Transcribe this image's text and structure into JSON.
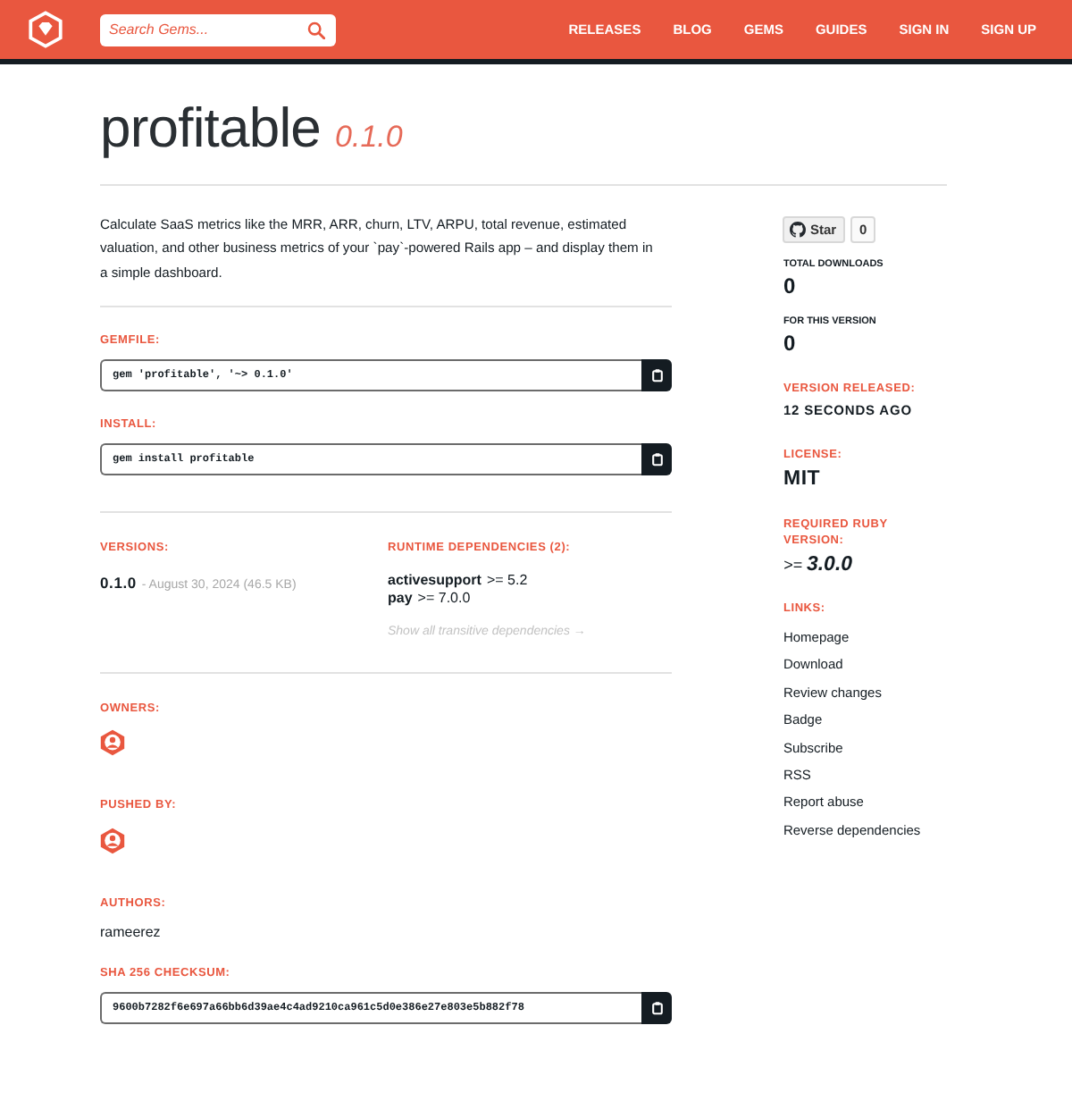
{
  "header": {
    "search": {
      "placeholder": "Search Gems..."
    },
    "nav": [
      "RELEASES",
      "BLOG",
      "GEMS",
      "GUIDES",
      "SIGN IN",
      "SIGN UP"
    ]
  },
  "gem": {
    "name": "profitable",
    "version": "0.1.0"
  },
  "description": "Calculate SaaS metrics like the MRR, ARR, churn, LTV, ARPU, total revenue, estimated valuation, and other business metrics of your `pay`-powered Rails app – and display them in a simple dashboard.",
  "install": [
    {
      "label": "GEMFILE:",
      "command": "gem 'profitable', '~> 0.1.0'"
    },
    {
      "label": "INSTALL:",
      "command": "gem install profitable"
    }
  ],
  "versions": {
    "label": "VERSIONS:",
    "items": [
      {
        "number": "0.1.0",
        "details": "- August 30, 2024 (46.5 KB)"
      }
    ]
  },
  "dependencies": {
    "label": "RUNTIME DEPENDENCIES (2):",
    "items": [
      {
        "name": "activesupport",
        "requirement": ">= 5.2"
      },
      {
        "name": "pay",
        "requirement": ">= 7.0.0"
      }
    ],
    "more_link": "Show all transitive dependencies →"
  },
  "owners": {
    "label": "OWNERS:",
    "users": [
      {
        "kind": "avatar"
      }
    ]
  },
  "pushed_by": {
    "label": "PUSHED BY:",
    "users": [
      {
        "kind": "avatar"
      }
    ]
  },
  "authors": {
    "label": "AUTHORS:",
    "value": "rameerez"
  },
  "checksum": {
    "label": "SHA 256 CHECKSUM:",
    "value": "9600b7282f6e697a66bb6d39ae4c4ad9210ca961c5d0e386e27e803e5b882f78"
  },
  "sidebar": {
    "star": {
      "label": "Star",
      "count": "0"
    },
    "stats": [
      {
        "label": "TOTAL DOWNLOADS",
        "value": "0"
      },
      {
        "label": "FOR THIS VERSION",
        "value": "0"
      }
    ],
    "meta": [
      {
        "label": "VERSION RELEASED:",
        "value": "12 SECONDS AGO",
        "kind": "caps"
      },
      {
        "label": "LICENSE:",
        "value": "MIT",
        "kind": "large"
      },
      {
        "label": "REQUIRED RUBY VERSION:",
        "value": ">= **3.0.0**",
        "kind": "italic"
      }
    ],
    "links": {
      "label": "LINKS:",
      "items": [
        "Homepage",
        "Download",
        "Review changes",
        "Badge",
        "Subscribe",
        "RSS",
        "Report abuse",
        "Reverse dependencies"
      ]
    }
  }
}
